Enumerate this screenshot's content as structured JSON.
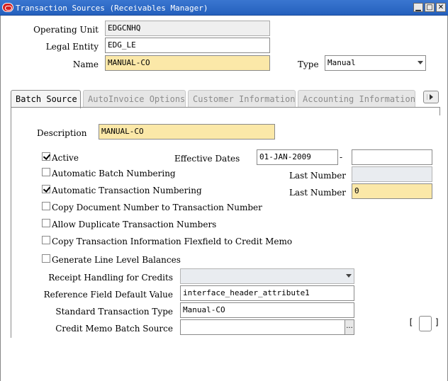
{
  "window": {
    "title": "Transaction Sources (Receivables Manager)"
  },
  "header": {
    "operating_unit_label": "Operating Unit",
    "operating_unit_value": "EDGCNHQ",
    "legal_entity_label": "Legal Entity",
    "legal_entity_value": "EDG_LE",
    "name_label": "Name",
    "name_value": "MANUAL-CO",
    "type_label": "Type",
    "type_value": "Manual"
  },
  "tabs": [
    {
      "label": "Batch Source",
      "active": true
    },
    {
      "label": "AutoInvoice Options",
      "active": false
    },
    {
      "label": "Customer Information",
      "active": false
    },
    {
      "label": "Accounting Information",
      "active": false
    }
  ],
  "batch_source": {
    "description_label": "Description",
    "description_value": "MANUAL-CO",
    "active_label": "Active",
    "active_checked": true,
    "effective_dates_label": "Effective Dates",
    "effective_from": "01-JAN-2009",
    "effective_dash": "-",
    "effective_to": "",
    "auto_batch_label": "Automatic Batch Numbering",
    "auto_batch_checked": false,
    "last_number_label_1": "Last Number",
    "last_number_value_1": "",
    "auto_txn_label": "Automatic Transaction Numbering",
    "auto_txn_checked": true,
    "last_number_label_2": "Last Number",
    "last_number_value_2": "0",
    "copy_doc_label": "Copy Document Number to Transaction Number",
    "copy_doc_checked": false,
    "allow_dup_label": "Allow Duplicate Transaction Numbers",
    "allow_dup_checked": false,
    "copy_flex_label": "Copy Transaction Information Flexfield to Credit Memo",
    "copy_flex_checked": false,
    "gen_line_label": "Generate Line Level Balances",
    "gen_line_checked": false,
    "receipt_handling_label": "Receipt Handling for Credits",
    "receipt_handling_value": "",
    "ref_field_label": "Reference Field Default Value",
    "ref_field_value": "interface_header_attribute1",
    "std_txn_type_label": "Standard Transaction Type",
    "std_txn_type_value": "Manual-CO",
    "cm_batch_label": "Credit Memo Batch Source",
    "cm_batch_value": "",
    "lov_glyph": "...",
    "dff_open": "[",
    "dff_close": "]"
  }
}
